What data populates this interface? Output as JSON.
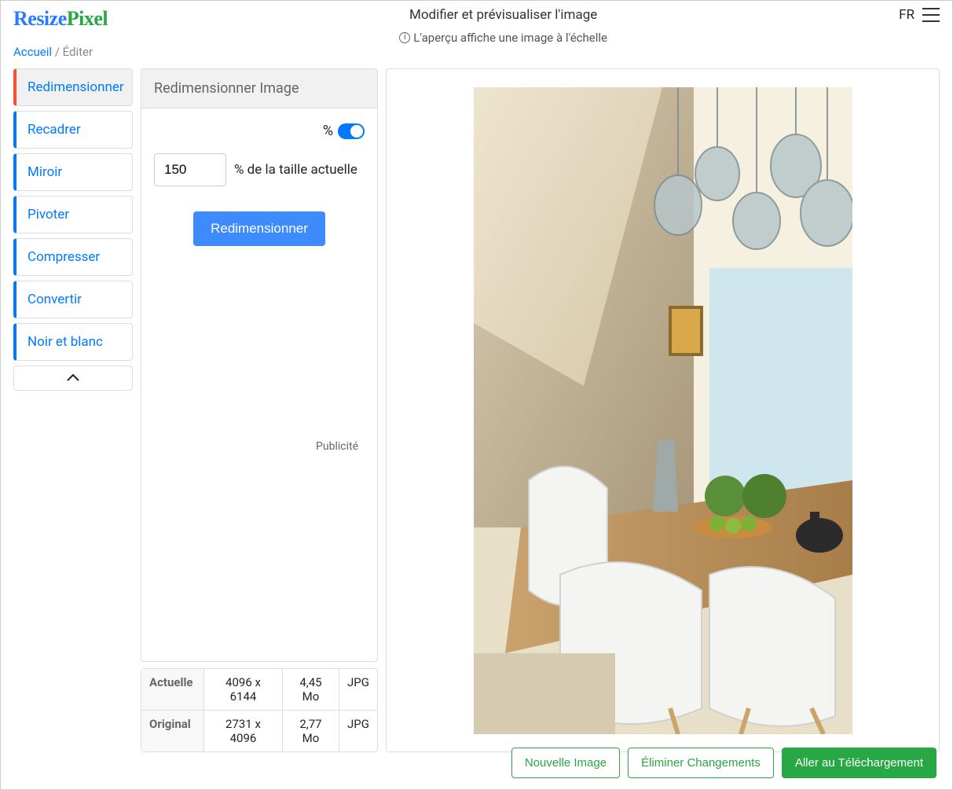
{
  "header": {
    "logo_a": "Resize",
    "logo_b": "Pixel",
    "title": "Modifier et prévisualiser l'image",
    "subtitle": "L'aperçu affiche une image à l'échelle",
    "lang": "FR"
  },
  "breadcrumb": {
    "home": "Accueil",
    "current": "Éditer"
  },
  "sidebar": {
    "items": [
      {
        "label": "Redimensionner"
      },
      {
        "label": "Recadrer"
      },
      {
        "label": "Miroir"
      },
      {
        "label": "Pivoter"
      },
      {
        "label": "Compresser"
      },
      {
        "label": "Convertir"
      },
      {
        "label": "Noir et blanc"
      }
    ]
  },
  "panel": {
    "title": "Redimensionner Image",
    "toggle_label": "%",
    "percent_value": "150",
    "percent_suffix": "% de la taille actuelle",
    "button": "Redimensionner",
    "ad_label": "Publicité"
  },
  "info": {
    "rows": [
      {
        "label": "Actuelle",
        "dims": "4096 x 6144",
        "size": "4,45 Mo",
        "fmt": "JPG"
      },
      {
        "label": "Original",
        "dims": "2731 x 4096",
        "size": "2,77 Mo",
        "fmt": "JPG"
      }
    ]
  },
  "footer": {
    "new_image": "Nouvelle Image",
    "discard": "Éliminer Changements",
    "download": "Aller au Téléchargement"
  }
}
